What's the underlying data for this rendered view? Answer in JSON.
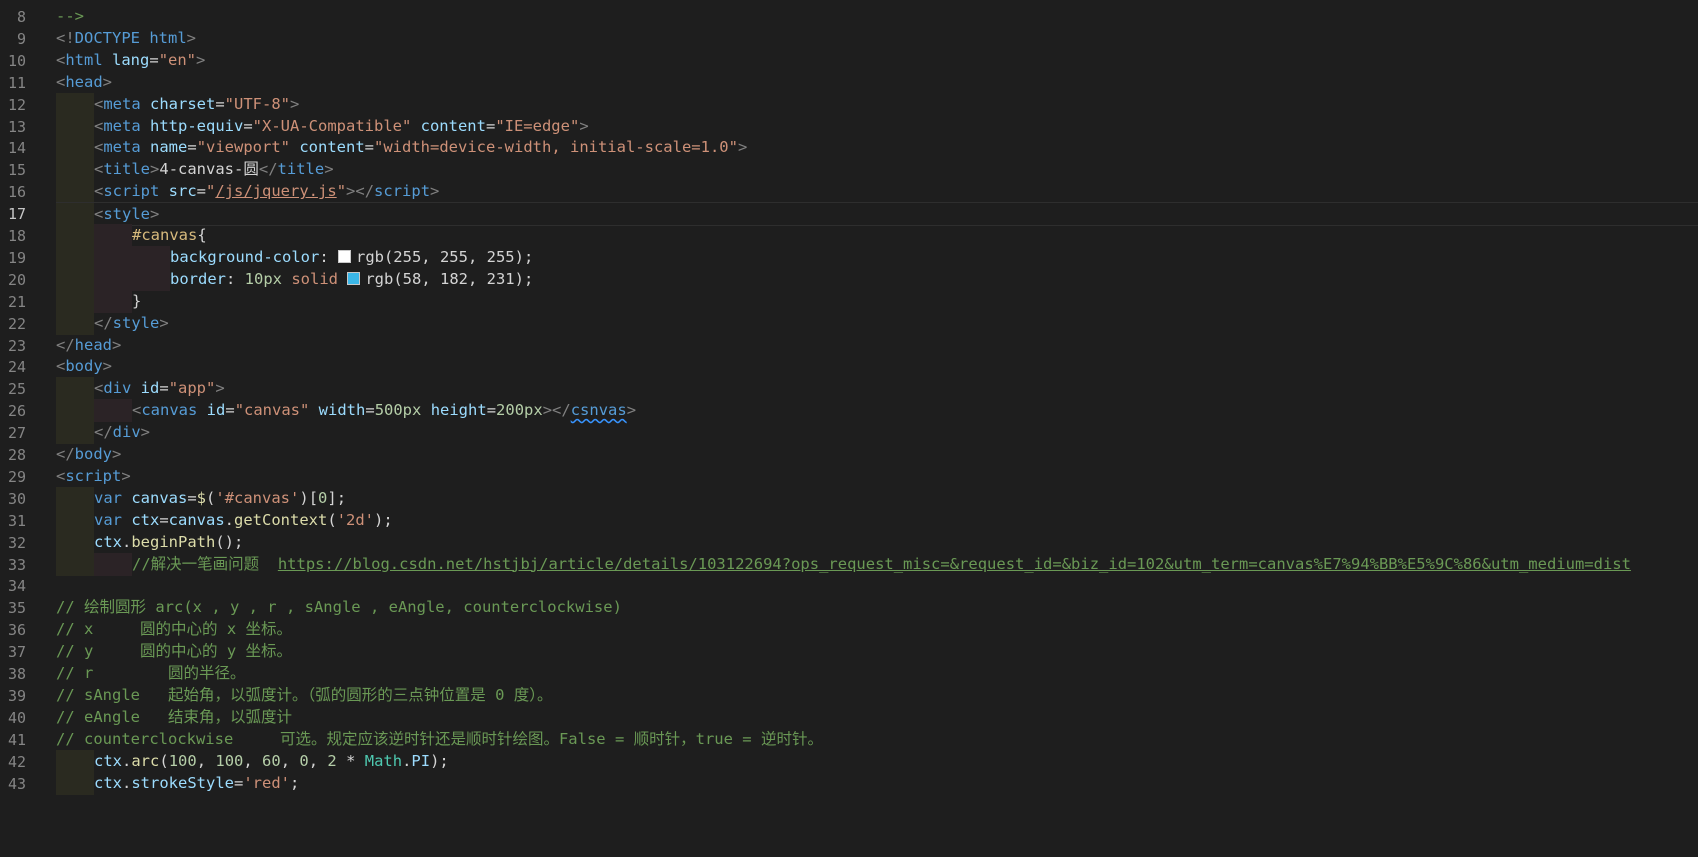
{
  "editor": {
    "line_numbers": [
      "8",
      "9",
      "10",
      "11",
      "12",
      "13",
      "14",
      "15",
      "16",
      "17",
      "18",
      "19",
      "20",
      "21",
      "22",
      "23",
      "24",
      "25",
      "26",
      "27",
      "28",
      "29",
      "30",
      "31",
      "32",
      "33",
      "34",
      "35",
      "36",
      "37",
      "38",
      "39",
      "40",
      "41",
      "42",
      "43"
    ],
    "active_line": "17",
    "colors": {
      "background": "#1e1e1e",
      "swatch_white": "#ffffff",
      "swatch_blue": "#3ab6e7"
    },
    "lines": [
      [
        "-->"
      ],
      [
        "<!",
        "DOCTYPE",
        " html",
        ">"
      ],
      [
        "<",
        "html",
        " lang",
        "=",
        "\"en\"",
        ">"
      ],
      [
        "<",
        "head",
        ">"
      ],
      [
        "<",
        "meta",
        " charset",
        "=",
        "\"UTF-8\"",
        ">"
      ],
      [
        "<",
        "meta",
        " http-equiv",
        "=",
        "\"X-UA-Compatible\"",
        " content",
        "=",
        "\"IE=edge\"",
        ">"
      ],
      [
        "<",
        "meta",
        " name",
        "=",
        "\"viewport\"",
        " content",
        "=",
        "\"width=device-width, initial-scale=1.0\"",
        ">"
      ],
      [
        "<",
        "title",
        ">",
        "4-canvas-圆",
        "</",
        "title",
        ">"
      ],
      [
        "<",
        "script",
        " src",
        "=",
        "\"",
        "/js/jquery.js",
        "\"",
        "></",
        "script",
        ">"
      ],
      [
        "<",
        "style",
        ">"
      ],
      [
        "#canvas",
        "{"
      ],
      [
        "background-color",
        ": ",
        "rgb(255, 255, 255);"
      ],
      [
        "border",
        ": ",
        "10px",
        " solid ",
        "rgb(58, 182, 231);"
      ],
      [
        "}"
      ],
      [
        "</",
        "style",
        ">"
      ],
      [
        "</",
        "head",
        ">"
      ],
      [
        "<",
        "body",
        ">"
      ],
      [
        "<",
        "div",
        " id",
        "=",
        "\"app\"",
        ">"
      ],
      [
        "<",
        "canvas",
        " id",
        "=",
        "\"canvas\"",
        " width",
        "=",
        "500px",
        " height",
        "=",
        "200px",
        "></",
        "csnvas",
        ">"
      ],
      [
        "</",
        "div",
        ">"
      ],
      [
        "</",
        "body",
        ">"
      ],
      [
        "<",
        "script",
        ">"
      ],
      [
        "var",
        " canvas",
        "=",
        "$",
        "(",
        "'#canvas'",
        ")[",
        "0",
        "];"
      ],
      [
        "var",
        " ctx",
        "=",
        "canvas",
        ".",
        "getContext",
        "(",
        "'2d'",
        ");"
      ],
      [
        "ctx",
        ".",
        "beginPath",
        "();"
      ],
      [
        "//解决一笔画问题  ",
        "https://blog.csdn.net/hstjbj/article/details/103122694?ops_request_misc=&request_id=&biz_id=102&utm_term=canvas%E7%94%BB%E5%9C%86&utm_medium=dist"
      ],
      [
        ""
      ],
      [
        "// 绘制圆形 arc(x , y , r , sAngle , eAngle, counterclockwise)"
      ],
      [
        "// x     圆的中心的 x 坐标。"
      ],
      [
        "// y     圆的中心的 y 坐标。"
      ],
      [
        "// r        圆的半径。"
      ],
      [
        "// sAngle   起始角，以弧度计。（弧的圆形的三点钟位置是 0 度）。"
      ],
      [
        "// eAngle   结束角，以弧度计"
      ],
      [
        "// counterclockwise     可选。规定应该逆时针还是顺时针绘图。False = 顺时针，true = 逆时针。"
      ],
      [
        "ctx",
        ".",
        "arc",
        "(",
        "100",
        ", ",
        "100",
        ", ",
        "60",
        ", ",
        "0",
        ", ",
        "2",
        " * ",
        "Math",
        ".",
        "PI",
        ");"
      ],
      [
        "ctx",
        ".",
        "strokeStyle",
        "=",
        "'red'",
        ";"
      ]
    ]
  }
}
